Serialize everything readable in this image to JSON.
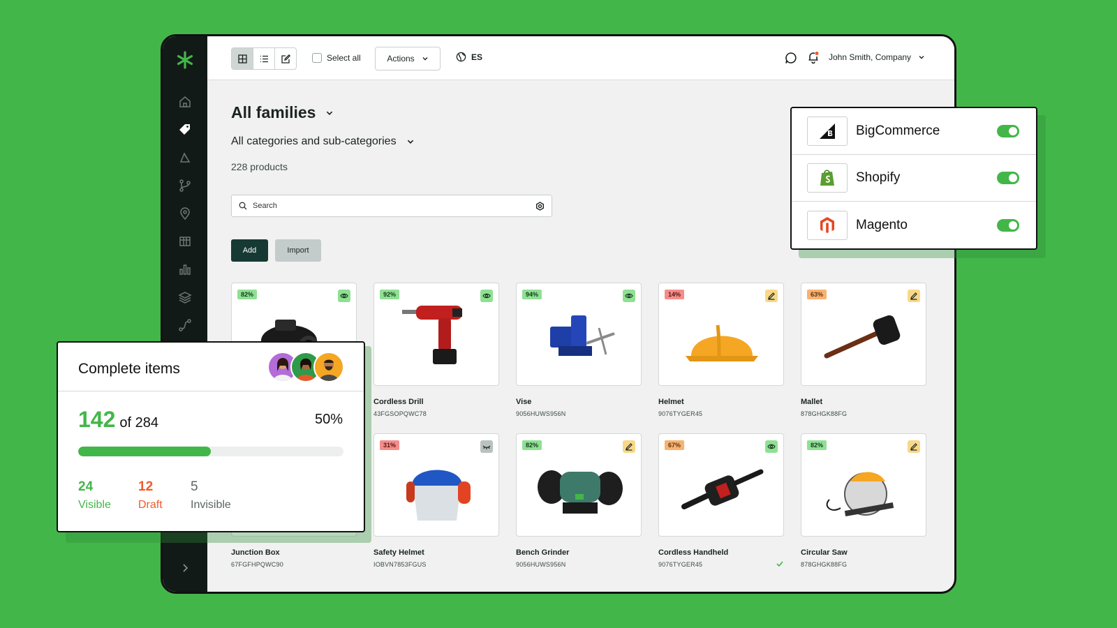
{
  "toolbar": {
    "select_all": "Select all",
    "actions": "Actions",
    "language": "ES",
    "user": "John Smith, Company"
  },
  "header": {
    "family": "All families",
    "categories": "All categories and sub-categories",
    "product_count": "228 products"
  },
  "search": {
    "placeholder": "Search"
  },
  "buttons": {
    "add": "Add",
    "import": "Import"
  },
  "products": [
    {
      "name": "Junction Box",
      "sku": "67FGFHPQWC90",
      "completeness": "82%",
      "status": "visible"
    },
    {
      "name": "Cordless Drill",
      "sku": "43FGSOPQWC78",
      "completeness": "92%",
      "status": "visible"
    },
    {
      "name": "Vise",
      "sku": "9056HUWS956N",
      "completeness": "94%",
      "status": "visible"
    },
    {
      "name": "Helmet",
      "sku": "9076TYGER45",
      "completeness": "14%",
      "status": "draft"
    },
    {
      "name": "Mallet",
      "sku": "878GHGK88FG",
      "completeness": "63%",
      "status": "draft"
    },
    {
      "name": "Safety Helmet",
      "sku": "IOBVN7853FGUS",
      "completeness": "31%",
      "status": "invisible"
    },
    {
      "name": "Bench Grinder",
      "sku": "9056HUWS956N",
      "completeness": "82%",
      "status": "draft"
    },
    {
      "name": "Cordless Handheld",
      "sku": "9076TYGER45",
      "completeness": "67%",
      "status": "visible"
    },
    {
      "name": "Circular Saw",
      "sku": "878GHGK88FG",
      "completeness": "82%",
      "status": "draft"
    }
  ],
  "integrations": [
    {
      "name": "BigCommerce",
      "enabled": true
    },
    {
      "name": "Shopify",
      "enabled": true
    },
    {
      "name": "Magento",
      "enabled": true
    }
  ],
  "complete_items": {
    "title": "Complete items",
    "complete": "142",
    "of_total": "of 284",
    "percent_label": "50%",
    "percent": 50,
    "visible_count": "24",
    "visible_label": "Visible",
    "draft_count": "12",
    "draft_label": "Draft",
    "invisible_count": "5",
    "invisible_label": "Invisible"
  },
  "colors": {
    "background": "#43b649",
    "sidebar": "#121a17",
    "accent_green": "#43b649",
    "draft_orange": "#f05a2a",
    "primary_button": "#163a33"
  },
  "icons": {
    "sidebar": [
      "home-icon",
      "tag-icon",
      "shapes-icon",
      "branch-icon",
      "location-icon",
      "table-icon",
      "chart-icon",
      "layers-icon",
      "workflow-icon"
    ],
    "status": {
      "visible": "eye-icon",
      "draft": "pencil-icon",
      "invisible": "eye-closed-icon"
    }
  }
}
